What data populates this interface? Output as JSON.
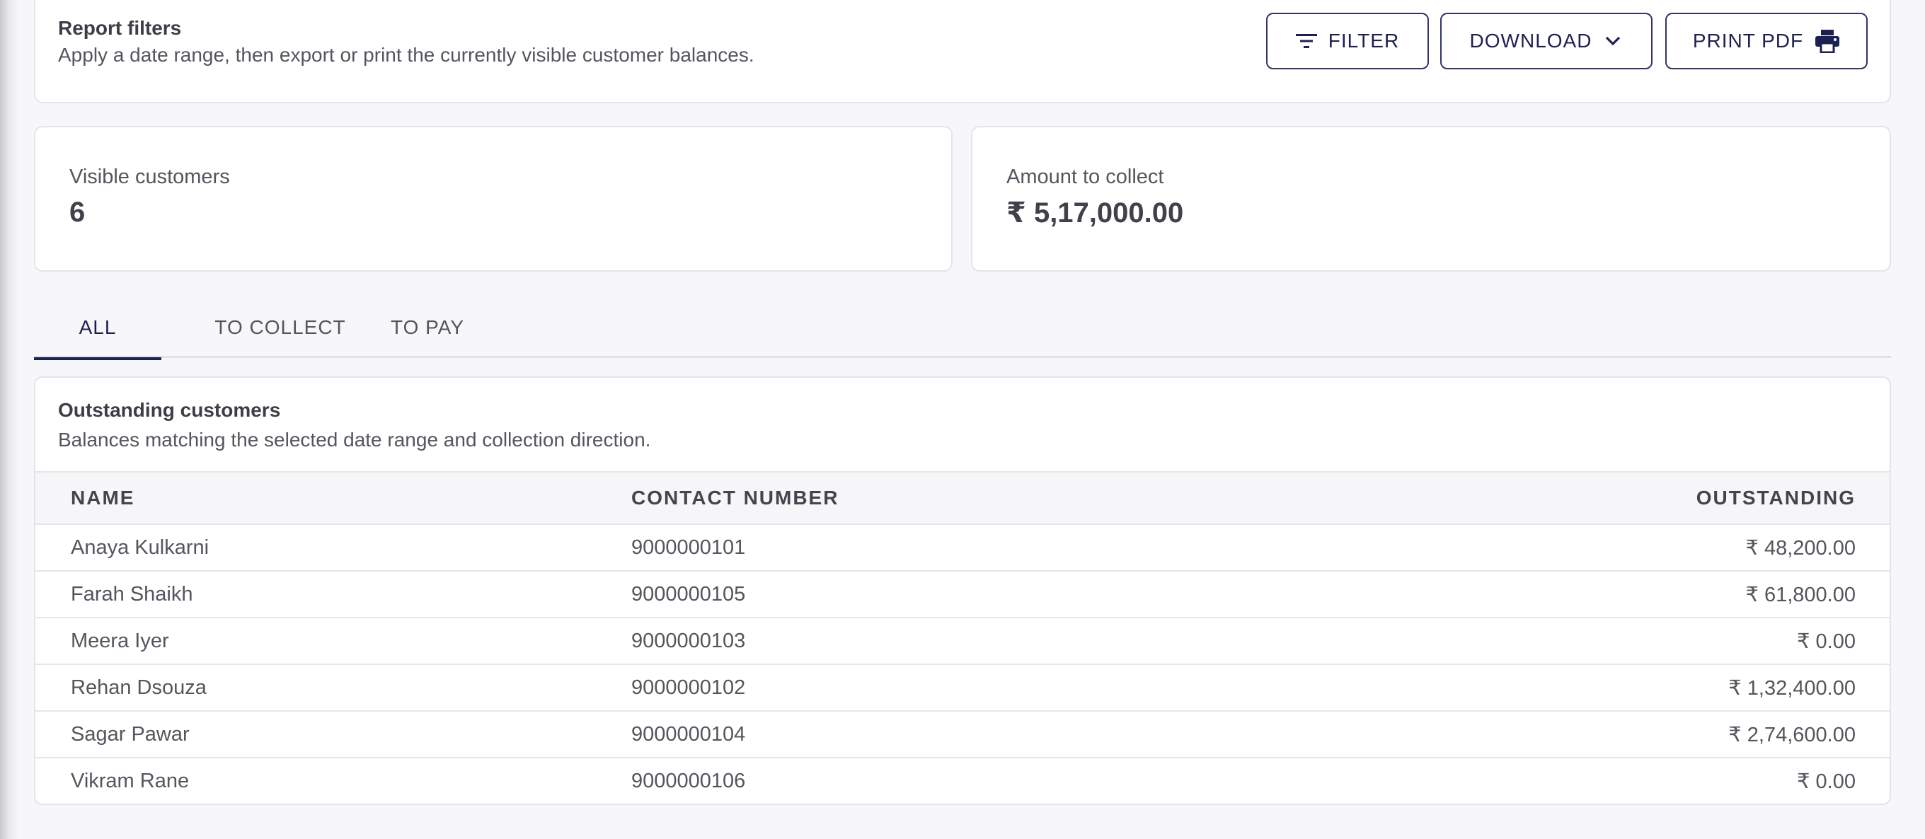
{
  "filters": {
    "title": "Report filters",
    "subtitle": "Apply a date range, then export or print the currently visible customer balances.",
    "filter_label": "FILTER",
    "download_label": "DOWNLOAD",
    "print_label": "PRINT PDF"
  },
  "stats": {
    "visible_label": "Visible customers",
    "visible_value": "6",
    "amount_label": "Amount to collect",
    "amount_value": "₹ 5,17,000.00"
  },
  "tabs": [
    {
      "label": "ALL",
      "active": true
    },
    {
      "label": "TO COLLECT",
      "active": false
    },
    {
      "label": "TO PAY",
      "active": false
    }
  ],
  "table": {
    "title": "Outstanding customers",
    "subtitle": "Balances matching the selected date range and collection direction.",
    "columns": [
      "NAME",
      "CONTACT NUMBER",
      "OUTSTANDING"
    ],
    "rows": [
      {
        "name": "Anaya Kulkarni",
        "contact": "9000000101",
        "outstanding": "₹ 48,200.00"
      },
      {
        "name": "Farah Shaikh",
        "contact": "9000000105",
        "outstanding": "₹ 61,800.00"
      },
      {
        "name": "Meera Iyer",
        "contact": "9000000103",
        "outstanding": "₹ 0.00"
      },
      {
        "name": "Rehan Dsouza",
        "contact": "9000000102",
        "outstanding": "₹ 1,32,400.00"
      },
      {
        "name": "Sagar Pawar",
        "contact": "9000000104",
        "outstanding": "₹ 2,74,600.00"
      },
      {
        "name": "Vikram Rane",
        "contact": "9000000106",
        "outstanding": "₹ 0.00"
      }
    ]
  },
  "icons": {
    "filter": "filter-lines-icon",
    "download": "chevron-down-icon",
    "print": "printer-icon"
  },
  "colors": {
    "accent": "#1d2152",
    "border": "#e4e4ea",
    "background": "#f7f7f9"
  }
}
